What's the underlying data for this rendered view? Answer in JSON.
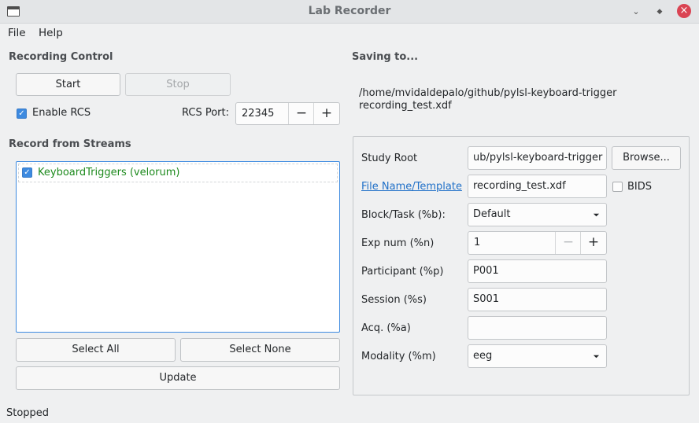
{
  "window": {
    "title": "Lab Recorder"
  },
  "menu": {
    "file": "File",
    "help": "Help"
  },
  "recording_control": {
    "title": "Recording Control",
    "start": "Start",
    "stop": "Stop",
    "enable_rcs": "Enable RCS",
    "enable_rcs_checked": true,
    "rcs_port_label": "RCS Port:",
    "rcs_port_value": "22345",
    "minus": "−",
    "plus": "+"
  },
  "streams": {
    "title": "Record from Streams",
    "items": [
      {
        "label": "KeyboardTriggers (velorum)",
        "checked": true
      }
    ],
    "select_all": "Select All",
    "select_none": "Select None",
    "update": "Update"
  },
  "saving": {
    "title": "Saving to...",
    "path_line1": "/home/mvidaldepalo/github/pylsl-keyboard-trigger",
    "path_line2": "recording_test.xdf"
  },
  "form": {
    "study_root_label": "Study Root",
    "study_root_value": "ub/pylsl-keyboard-trigger",
    "browse": "Browse...",
    "file_name_label": "File Name/Template",
    "file_name_value": "recording_test.xdf",
    "bids_label": "BIDS",
    "bids_checked": false,
    "block_label": "Block/Task (%b):",
    "block_value": "Default",
    "exp_label": "Exp num (%n)",
    "exp_value": "1",
    "participant_label": "Participant (%p)",
    "participant_value": "P001",
    "session_label": "Session (%s)",
    "session_value": "S001",
    "acq_label": "Acq. (%a)",
    "acq_value": "",
    "modality_label": "Modality (%m)",
    "modality_value": "eeg"
  },
  "status": {
    "text": "Stopped"
  }
}
